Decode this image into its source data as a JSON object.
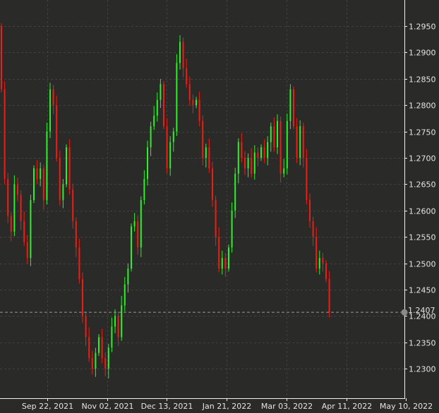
{
  "chart_data": {
    "type": "candlestick",
    "title": "",
    "xlabel": "",
    "ylabel": "",
    "ylim": [
      1.2255,
      1.2998
    ],
    "grid": true,
    "colors": {
      "up": "#2ef02a",
      "down": "#ee1c12",
      "background": "#2a2b29",
      "grid": "#40413f",
      "axis": "#f0f0f0",
      "marker": "#8a8a8a"
    },
    "y_ticks": [
      "1.2950",
      "1.2900",
      "1.2850",
      "1.2800",
      "1.2750",
      "1.2700",
      "1.2650",
      "1.2600",
      "1.2550",
      "1.2500",
      "1.2450",
      "1.2400",
      "1.2350",
      "1.2300"
    ],
    "x_ticks": [
      "Sep 22, 2021",
      "Nov 02, 2021",
      "Dec 13, 2021",
      "Jan 21, 2022",
      "Mar 03, 2022",
      "Apr 11, 2022",
      "May 10, 2022"
    ],
    "first_open": 1.295,
    "wick_pad": 0.0014,
    "closes": [
      1.283,
      1.266,
      1.259,
      1.256,
      1.265,
      1.263,
      1.258,
      1.254,
      1.251,
      1.262,
      1.268,
      1.266,
      1.268,
      1.262,
      1.275,
      1.283,
      1.28,
      1.27,
      1.262,
      1.265,
      1.272,
      1.264,
      1.258,
      1.253,
      1.247,
      1.24,
      1.236,
      1.232,
      1.23,
      1.233,
      1.236,
      1.232,
      1.23,
      1.234,
      1.238,
      1.24,
      1.236,
      1.242,
      1.246,
      1.249,
      1.257,
      1.258,
      1.253,
      1.262,
      1.266,
      1.272,
      1.276,
      1.278,
      1.281,
      1.284,
      1.276,
      1.268,
      1.273,
      1.275,
      1.288,
      1.292,
      1.287,
      1.284,
      1.281,
      1.28,
      1.281,
      1.277,
      1.27,
      1.272,
      1.268,
      1.262,
      1.255,
      1.249,
      1.251,
      1.249,
      1.253,
      1.26,
      1.267,
      1.273,
      1.27,
      1.268,
      1.27,
      1.267,
      1.271,
      1.27,
      1.272,
      1.27,
      1.273,
      1.276,
      1.272,
      1.277,
      1.267,
      1.268,
      1.277,
      1.283,
      1.276,
      1.27,
      1.276,
      1.27,
      1.262,
      1.258,
      1.255,
      1.249,
      1.251,
      1.25,
      1.247,
      1.2407
    ],
    "last_price": {
      "value": 1.2407,
      "label": "1.2407"
    }
  }
}
